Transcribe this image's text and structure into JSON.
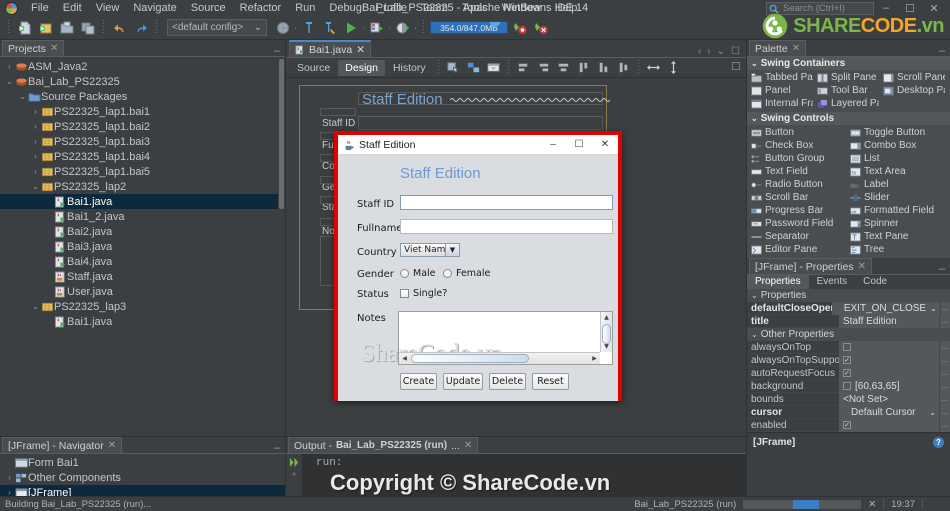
{
  "window": {
    "title": "Bai_Lab_PS22325 - Apache NetBeans IDE 14",
    "minimize": "–",
    "maximize": "☐",
    "close": "✕"
  },
  "menu": {
    "items": [
      "File",
      "Edit",
      "View",
      "Navigate",
      "Source",
      "Refactor",
      "Run",
      "Debug",
      "Profile",
      "Team",
      "Tools",
      "Window",
      "Help"
    ]
  },
  "search": {
    "placeholder": "Search (Ctrl+I)",
    "value": ""
  },
  "toolbar": {
    "config_value": "<default config>",
    "memory": "354.0/847.0MB",
    "icons": [
      "new-file-icon",
      "new-project-icon",
      "open-project-icon",
      "save-all-icon",
      "undo-icon",
      "redo-icon",
      "build-project-icon",
      "clean-build-icon",
      "run-project-icon",
      "debug-project-icon",
      "profile-project-icon",
      "toggle-breakpoint-icon",
      "new-breakpoint-icon"
    ]
  },
  "projects": {
    "tab_label": "Projects",
    "close": "✕",
    "minimize": "–",
    "nodes": [
      {
        "label": "ASM_Java2",
        "indent": 0,
        "arrow": "›",
        "icon": "project-icon",
        "selected": false
      },
      {
        "label": "Bai_Lab_PS22325",
        "indent": 0,
        "arrow": "⌄",
        "icon": "project-icon",
        "selected": false
      },
      {
        "label": "Source Packages",
        "indent": 1,
        "arrow": "⌄",
        "icon": "source-packages-icon",
        "selected": false
      },
      {
        "label": "PS22325_lap1.bai1",
        "indent": 2,
        "arrow": "›",
        "icon": "package-icon",
        "selected": false
      },
      {
        "label": "PS22325_lap1.bai2",
        "indent": 2,
        "arrow": "›",
        "icon": "package-icon",
        "selected": false
      },
      {
        "label": "PS22325_lap1.bai3",
        "indent": 2,
        "arrow": "›",
        "icon": "package-icon",
        "selected": false
      },
      {
        "label": "PS22325_lap1.bai4",
        "indent": 2,
        "arrow": "›",
        "icon": "package-icon",
        "selected": false
      },
      {
        "label": "PS22325_lap1.bai5",
        "indent": 2,
        "arrow": "›",
        "icon": "package-icon",
        "selected": false
      },
      {
        "label": "PS22325_lap2",
        "indent": 2,
        "arrow": "⌄",
        "icon": "package-icon",
        "selected": false
      },
      {
        "label": "Bai1.java",
        "indent": 3,
        "arrow": "",
        "icon": "java-main-icon",
        "selected": true
      },
      {
        "label": "Bai1_2.java",
        "indent": 3,
        "arrow": "",
        "icon": "java-main-icon",
        "selected": false
      },
      {
        "label": "Bai2.java",
        "indent": 3,
        "arrow": "",
        "icon": "java-main-icon",
        "selected": false
      },
      {
        "label": "Bai3.java",
        "indent": 3,
        "arrow": "",
        "icon": "java-main-icon",
        "selected": false
      },
      {
        "label": "Bai4.java",
        "indent": 3,
        "arrow": "",
        "icon": "java-main-icon",
        "selected": false
      },
      {
        "label": "Staff.java",
        "indent": 3,
        "arrow": "",
        "icon": "java-class-icon",
        "selected": false
      },
      {
        "label": "User.java",
        "indent": 3,
        "arrow": "",
        "icon": "java-class-icon",
        "selected": false
      },
      {
        "label": "PS22325_lap3",
        "indent": 2,
        "arrow": "⌄",
        "icon": "package-icon",
        "selected": false
      },
      {
        "label": "Bai1.java",
        "indent": 3,
        "arrow": "",
        "icon": "java-main-icon",
        "selected": false
      }
    ]
  },
  "navigator": {
    "tab_label": "[JFrame] - Navigator",
    "close": "✕",
    "minimize": "–",
    "nodes": [
      {
        "label": "Form Bai1",
        "indent": 0,
        "arrow": "",
        "icon": "form-icon",
        "selected": false
      },
      {
        "label": "Other Components",
        "indent": 0,
        "arrow": "›",
        "icon": "components-icon",
        "selected": false
      },
      {
        "label": "[JFrame]",
        "indent": 0,
        "arrow": "›",
        "icon": "jframe-icon",
        "selected": true
      }
    ]
  },
  "editor": {
    "tab_label": "Bai1.java",
    "tab_close": "✕",
    "nav_prev": "‹",
    "nav_next": "›",
    "nav_list": "⌄",
    "maximize": "☐",
    "view_tabs": [
      {
        "label": "Source",
        "active": false
      },
      {
        "label": "Design",
        "active": true
      },
      {
        "label": "History",
        "active": false
      }
    ],
    "tool_icons": [
      "select-mode-icon",
      "connection-mode-icon",
      "preview-design-icon",
      "align-left-icon",
      "align-right-icon",
      "align-center-icon",
      "align-top-icon",
      "align-bottom-icon",
      "align-middle-icon",
      "resize-horizontal-icon",
      "resize-vertical-icon"
    ]
  },
  "design_canvas": {
    "title": "Staff Edition",
    "labels": [
      "Staff ID",
      "Fullname",
      "Country",
      "Gender",
      "Status",
      "Notes"
    ]
  },
  "palette": {
    "tab_label": "Palette",
    "close": "✕",
    "minimize": "–",
    "categories": [
      {
        "name": "Swing Containers",
        "collapse": "⌄",
        "items": [
          {
            "label": "Tabbed Pane",
            "icon": "tabbed-pane-icon"
          },
          {
            "label": "Split Pane",
            "icon": "split-pane-icon"
          },
          {
            "label": "Scroll Pane",
            "icon": "scroll-pane-icon"
          },
          {
            "label": "Panel",
            "icon": "panel-icon"
          },
          {
            "label": "Tool Bar",
            "icon": "tool-bar-icon"
          },
          {
            "label": "Desktop Pane",
            "icon": "desktop-pane-icon"
          },
          {
            "label": "Internal Frame",
            "icon": "internal-frame-icon"
          },
          {
            "label": "Layered Pane",
            "icon": "layered-pane-icon"
          }
        ]
      },
      {
        "name": "Swing Controls",
        "collapse": "⌄",
        "items": [
          {
            "label": "Button",
            "icon": "button-icon"
          },
          {
            "label": "Toggle Button",
            "icon": "toggle-button-icon"
          },
          {
            "label": "Check Box",
            "icon": "check-box-icon"
          },
          {
            "label": "Combo Box",
            "icon": "combo-box-icon"
          },
          {
            "label": "Button Group",
            "icon": "button-group-icon"
          },
          {
            "label": "List",
            "icon": "list-icon"
          },
          {
            "label": "Text Field",
            "icon": "text-field-icon"
          },
          {
            "label": "Text Area",
            "icon": "text-area-icon"
          },
          {
            "label": "Radio Button",
            "icon": "radio-button-icon"
          },
          {
            "label": "Label",
            "icon": "label-icon"
          },
          {
            "label": "Scroll Bar",
            "icon": "scroll-bar-icon"
          },
          {
            "label": "Slider",
            "icon": "slider-icon"
          },
          {
            "label": "Progress Bar",
            "icon": "progress-bar-icon"
          },
          {
            "label": "Formatted Field",
            "icon": "formatted-field-icon"
          },
          {
            "label": "Password Field",
            "icon": "password-field-icon"
          },
          {
            "label": "Spinner",
            "icon": "spinner-icon"
          },
          {
            "label": "Separator",
            "icon": "separator-icon"
          },
          {
            "label": "Text Pane",
            "icon": "text-pane-icon"
          },
          {
            "label": "Editor Pane",
            "icon": "editor-pane-icon"
          },
          {
            "label": "Tree",
            "icon": "tree-icon"
          }
        ]
      }
    ]
  },
  "properties": {
    "tab_label": "[JFrame] - Properties",
    "close": "✕",
    "minimize": "–",
    "tabs": [
      {
        "label": "Properties",
        "active": true
      },
      {
        "label": "Events",
        "active": false
      },
      {
        "label": "Code",
        "active": false
      }
    ],
    "group_main": "Properties",
    "group_other": "Other Properties",
    "collapse": "⌄",
    "ellipsis": "...",
    "rows_main": [
      {
        "key": "defaultCloseOperation",
        "value": "EXIT_ON_CLOSE",
        "type": "dropdown",
        "bold": true
      },
      {
        "key": "title",
        "value": "Staff Edition",
        "type": "text",
        "bold": true
      }
    ],
    "rows_other": [
      {
        "key": "alwaysOnTop",
        "value": "",
        "type": "checkbox",
        "checked": false,
        "bold": false
      },
      {
        "key": "alwaysOnTopSupported",
        "value": "",
        "type": "checkbox",
        "checked": true,
        "bold": false
      },
      {
        "key": "autoRequestFocus",
        "value": "",
        "type": "checkbox",
        "checked": true,
        "bold": false
      },
      {
        "key": "background",
        "value": "[60,63,65]",
        "type": "color",
        "checked": false,
        "bold": false
      },
      {
        "key": "bounds",
        "value": "<Not Set>",
        "type": "text",
        "bold": false
      },
      {
        "key": "cursor",
        "value": "Default Cursor",
        "type": "dropdown",
        "bold": true
      },
      {
        "key": "enabled",
        "value": "",
        "type": "checkbox",
        "checked": true,
        "bold": false
      }
    ],
    "footer_label": "[JFrame]",
    "help_icon": "?"
  },
  "output": {
    "tab_label_prefix": "Output - ",
    "tab_label_bold": "Bai_Lab_PS22325 (run)",
    "tab_label_suffix": " ...",
    "close": "✕",
    "text": "run:",
    "rerun_icon": "»"
  },
  "statusbar": {
    "left_text": "Building Bai_Lab_PS22325 (run)...",
    "task_label": "Bai_Lab_PS22325 (run)",
    "cancel": "✕",
    "time": "19:37"
  },
  "dialog": {
    "titlebar_title": "Staff Edition",
    "icon": "java-coffee-icon",
    "minimize": "–",
    "maximize": "☐",
    "close": "✕",
    "heading": "Staff Edition",
    "fields": [
      {
        "label": "Staff ID",
        "value": "",
        "type": "text"
      },
      {
        "label": "Fullname",
        "value": "",
        "type": "text"
      }
    ],
    "country_label": "Country",
    "country_value": "Viet Nam",
    "country_arrow": "▼",
    "gender_label": "Gender",
    "gender_options": [
      "Male",
      "Female"
    ],
    "status_label": "Status",
    "status_option": "Single?",
    "notes_label": "Notes",
    "notes_value": "",
    "notes_watermark": "ShareCode.vn",
    "scroll_up": "▲",
    "scroll_down": "▼",
    "scroll_left": "◀",
    "scroll_right": "▶",
    "buttons": [
      "Create",
      "Update",
      "Delete",
      "Reset"
    ]
  },
  "watermark": {
    "logo_share": "SHARE",
    "logo_code": "CODE",
    "logo_vn": ".vn",
    "copyright": "Copyright © ShareCode.vn",
    "green": "#7ab648",
    "orange": "#f5a623"
  }
}
